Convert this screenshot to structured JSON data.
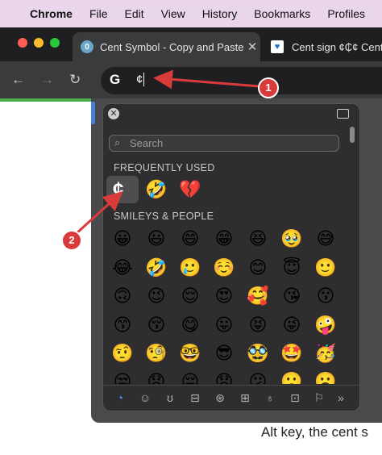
{
  "menubar": {
    "app": "Chrome",
    "items": [
      "File",
      "Edit",
      "View",
      "History",
      "Bookmarks",
      "Profiles"
    ]
  },
  "tabs": [
    {
      "title": "Cent Symbol - Copy and Paste",
      "favicon": "cent-favicon"
    },
    {
      "title": "Cent sign ¢₵¢ Cent s",
      "favicon": "heart-favicon"
    }
  ],
  "omnibox": {
    "value": "¢"
  },
  "picker": {
    "search_placeholder": "Search",
    "sections": {
      "frequent": "FREQUENTLY USED",
      "smileys": "SMILEYS & PEOPLE"
    },
    "frequent": [
      "¢",
      "🤣",
      "💔"
    ],
    "smileys": [
      [
        "😀",
        "😃",
        "😄",
        "😁",
        "😆",
        "🥹",
        "😅"
      ],
      [
        "😂",
        "🤣",
        "🥲",
        "☺️",
        "😊",
        "😇",
        "🙂"
      ],
      [
        "🙃",
        "😉",
        "😌",
        "😍",
        "🥰",
        "😘",
        "😗"
      ],
      [
        "😙",
        "😚",
        "😋",
        "😛",
        "😝",
        "😜",
        "🤪"
      ],
      [
        "🤨",
        "🧐",
        "🤓",
        "😎",
        "🥸",
        "🤩",
        "🥳"
      ]
    ],
    "categories": [
      "clock-icon",
      "smiley-icon",
      "animal-icon",
      "food-icon",
      "ball-icon",
      "car-icon",
      "bulb-icon",
      "symbol-icon",
      "flag-icon",
      "more-icon"
    ]
  },
  "annotations": {
    "badge1": "1",
    "badge2": "2",
    "color": "#d93a3a"
  },
  "caption": "Alt key, the cent s"
}
